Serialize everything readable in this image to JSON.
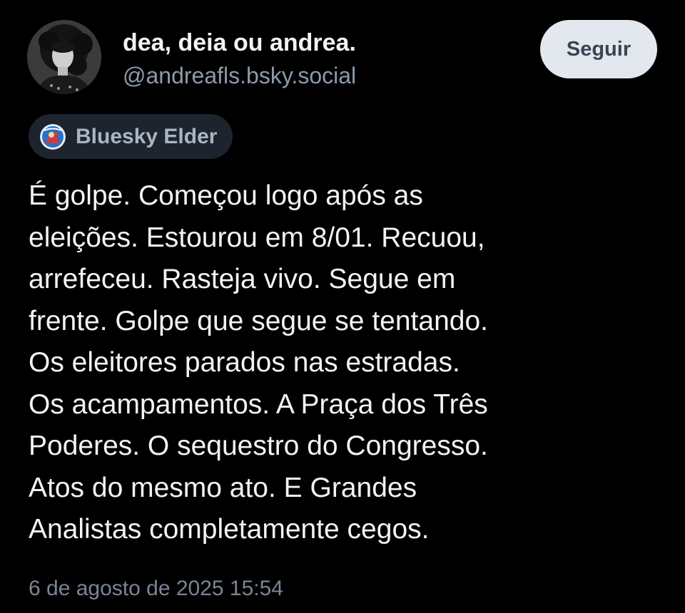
{
  "author": {
    "display_name": "dea, deia ou andrea.",
    "handle": "@andreafls.bsky.social",
    "avatar_icon": "profile-photo-icon"
  },
  "follow_button": {
    "label": "Seguir"
  },
  "badge": {
    "label": "Bluesky Elder",
    "icon": "elder-badge-icon"
  },
  "post": {
    "lines": [
      "É golpe. Começou logo após as",
      "eleições. Estourou em 8/01. Recuou,",
      "arrefeceu. Rasteja vivo. Segue em",
      "frente. Golpe que segue se tentando.",
      "Os eleitores parados nas estradas.",
      "Os acampamentos. A Praça dos Três",
      "Poderes. O sequestro do Congresso.",
      "Atos do mesmo ato. E Grandes",
      "Analistas completamente cegos."
    ],
    "timestamp": "6 de agosto de 2025 15:54"
  },
  "colors": {
    "background": "#000000",
    "text": "#f1f3f5",
    "muted": "#8d9aab",
    "button_bg": "#e3e8ef",
    "badge_bg": "#1d242d"
  }
}
